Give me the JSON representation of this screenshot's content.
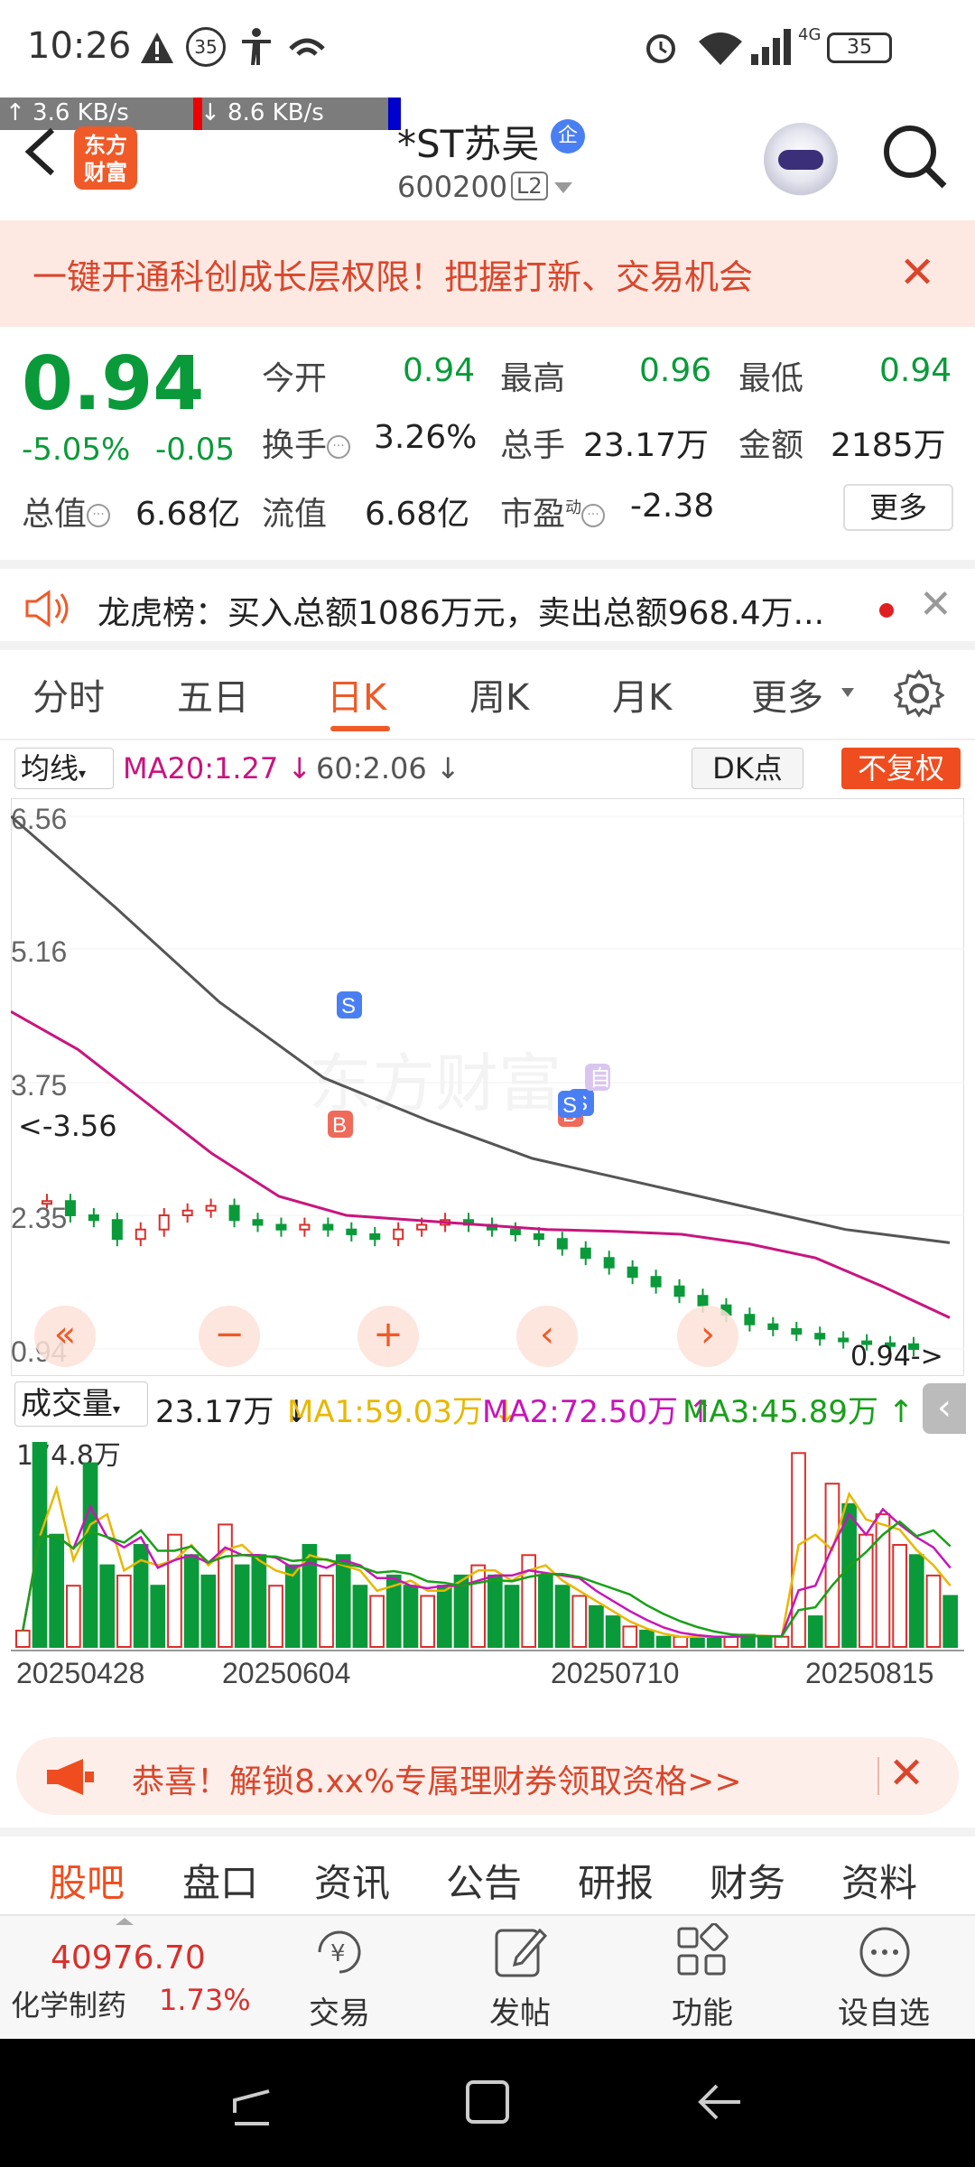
{
  "status_bar": {
    "time": "10:26",
    "badge": "35",
    "network": "4G",
    "battery": "35",
    "upload_speed": "↑      3.6 KB/s",
    "download_speed": "↓      8.6 KB/s"
  },
  "header": {
    "logo_text_1": "东方",
    "logo_text_2": "财富",
    "stock_name": "*ST苏吴",
    "badge": "企",
    "stock_code": "600200",
    "level": "L2"
  },
  "banner": {
    "text": "一键开通科创成长层权限！把握打新、交易机会",
    "close": "✕"
  },
  "quote": {
    "price": "0.94",
    "change_pct": "-5.05%",
    "change": "-0.05",
    "labels": {
      "open": "今开",
      "high": "最高",
      "low": "最低",
      "turnover": "换手",
      "volume": "总手",
      "amount": "金额",
      "market_cap": "总值",
      "float_cap": "流值",
      "pe": "市盈",
      "pe_sup": "动"
    },
    "values": {
      "open": "0.94",
      "high": "0.96",
      "low": "0.94",
      "turnover": "3.26%",
      "volume": "23.17万",
      "amount": "2185万",
      "market_cap": "6.68亿",
      "float_cap": "6.68亿",
      "pe": "-2.38"
    },
    "more": "更多"
  },
  "news": {
    "text": "龙虎榜：买入总额1086万元，卖出总额968.4万...",
    "close": "✕"
  },
  "tabs": [
    "分时",
    "五日",
    "日K",
    "周K",
    "月K",
    "更多"
  ],
  "active_tab": "日K",
  "indicator": {
    "select": "均线",
    "ma20": "MA20:1.27 ↓",
    "ma60": "60:2.06 ↓",
    "dk": "DK点",
    "fuquan": "不复权"
  },
  "chart_data": {
    "type": "candlestick",
    "price_axis_labels": [
      "6.56",
      "5.16",
      "3.75",
      "2.35",
      "0.94"
    ],
    "marker_low": "<-3.56",
    "current_marker": "0.94->",
    "signals": [
      "S",
      "B",
      "S",
      "B",
      "S",
      "自"
    ],
    "watermark": "东方财富",
    "ma20_values": [
      4.5,
      4.1,
      3.55,
      3.0,
      2.55,
      2.35,
      2.3,
      2.25,
      2.2,
      2.18,
      2.15,
      2.05,
      1.9,
      1.6,
      1.27
    ],
    "ma60_values": [
      6.56,
      5.6,
      4.6,
      3.8,
      3.35,
      2.95,
      2.7,
      2.45,
      2.2,
      2.06
    ],
    "closes": [
      2.5,
      2.35,
      2.3,
      2.1,
      2.2,
      2.35,
      2.4,
      2.45,
      2.3,
      2.25,
      2.2,
      2.25,
      2.2,
      2.15,
      2.1,
      2.2,
      2.25,
      2.3,
      2.25,
      2.2,
      2.15,
      2.1,
      2.0,
      1.9,
      1.8,
      1.7,
      1.6,
      1.5,
      1.4,
      1.3,
      1.2,
      1.15,
      1.1,
      1.05,
      1.02,
      1.0,
      0.99,
      0.94
    ]
  },
  "chart_controls": [
    "«",
    "−",
    "+",
    "‹",
    "›"
  ],
  "volume": {
    "select": "成交量",
    "value": "23.17万 ↓",
    "ma1": "MA1:59.03万 ↓",
    "ma2": "MA2:72.50万 ↑",
    "ma3": "MA3:45.89万 ↑",
    "max_label": "174.8万",
    "dates": [
      "20250428",
      "20250604",
      "20250710",
      "20250815"
    ],
    "bars": [
      0.08,
      1.0,
      0.55,
      0.3,
      0.9,
      0.4,
      0.35,
      0.5,
      0.3,
      0.55,
      0.45,
      0.35,
      0.6,
      0.4,
      0.45,
      0.3,
      0.4,
      0.5,
      0.35,
      0.45,
      0.3,
      0.25,
      0.35,
      0.3,
      0.25,
      0.3,
      0.35,
      0.4,
      0.35,
      0.3,
      0.45,
      0.35,
      0.3,
      0.25,
      0.2,
      0.15,
      0.1,
      0.08,
      0.05,
      0.05,
      0.05,
      0.05,
      0.05,
      0.06,
      0.05,
      0.05,
      0.95,
      0.15,
      0.8,
      0.7,
      0.55,
      0.65,
      0.5,
      0.45,
      0.35,
      0.25
    ]
  },
  "promo": {
    "text": "恭喜！解锁8.xx%专属理财券领取资格>>",
    "close": "✕"
  },
  "bottom_tabs": [
    "股吧",
    "盘口",
    "资讯",
    "公告",
    "研报",
    "财务",
    "资料"
  ],
  "active_bottom_tab": "股吧",
  "index": {
    "value": "40976.70",
    "name": "化学制药",
    "change": "1.73%"
  },
  "bottom_actions": [
    "交易",
    "发帖",
    "功能",
    "设自选"
  ],
  "colors": {
    "accent": "#ef5a28",
    "down": "#0a9a3a",
    "up": "#d9302c",
    "ma20": "#c8157e",
    "ma60": "#555555"
  }
}
